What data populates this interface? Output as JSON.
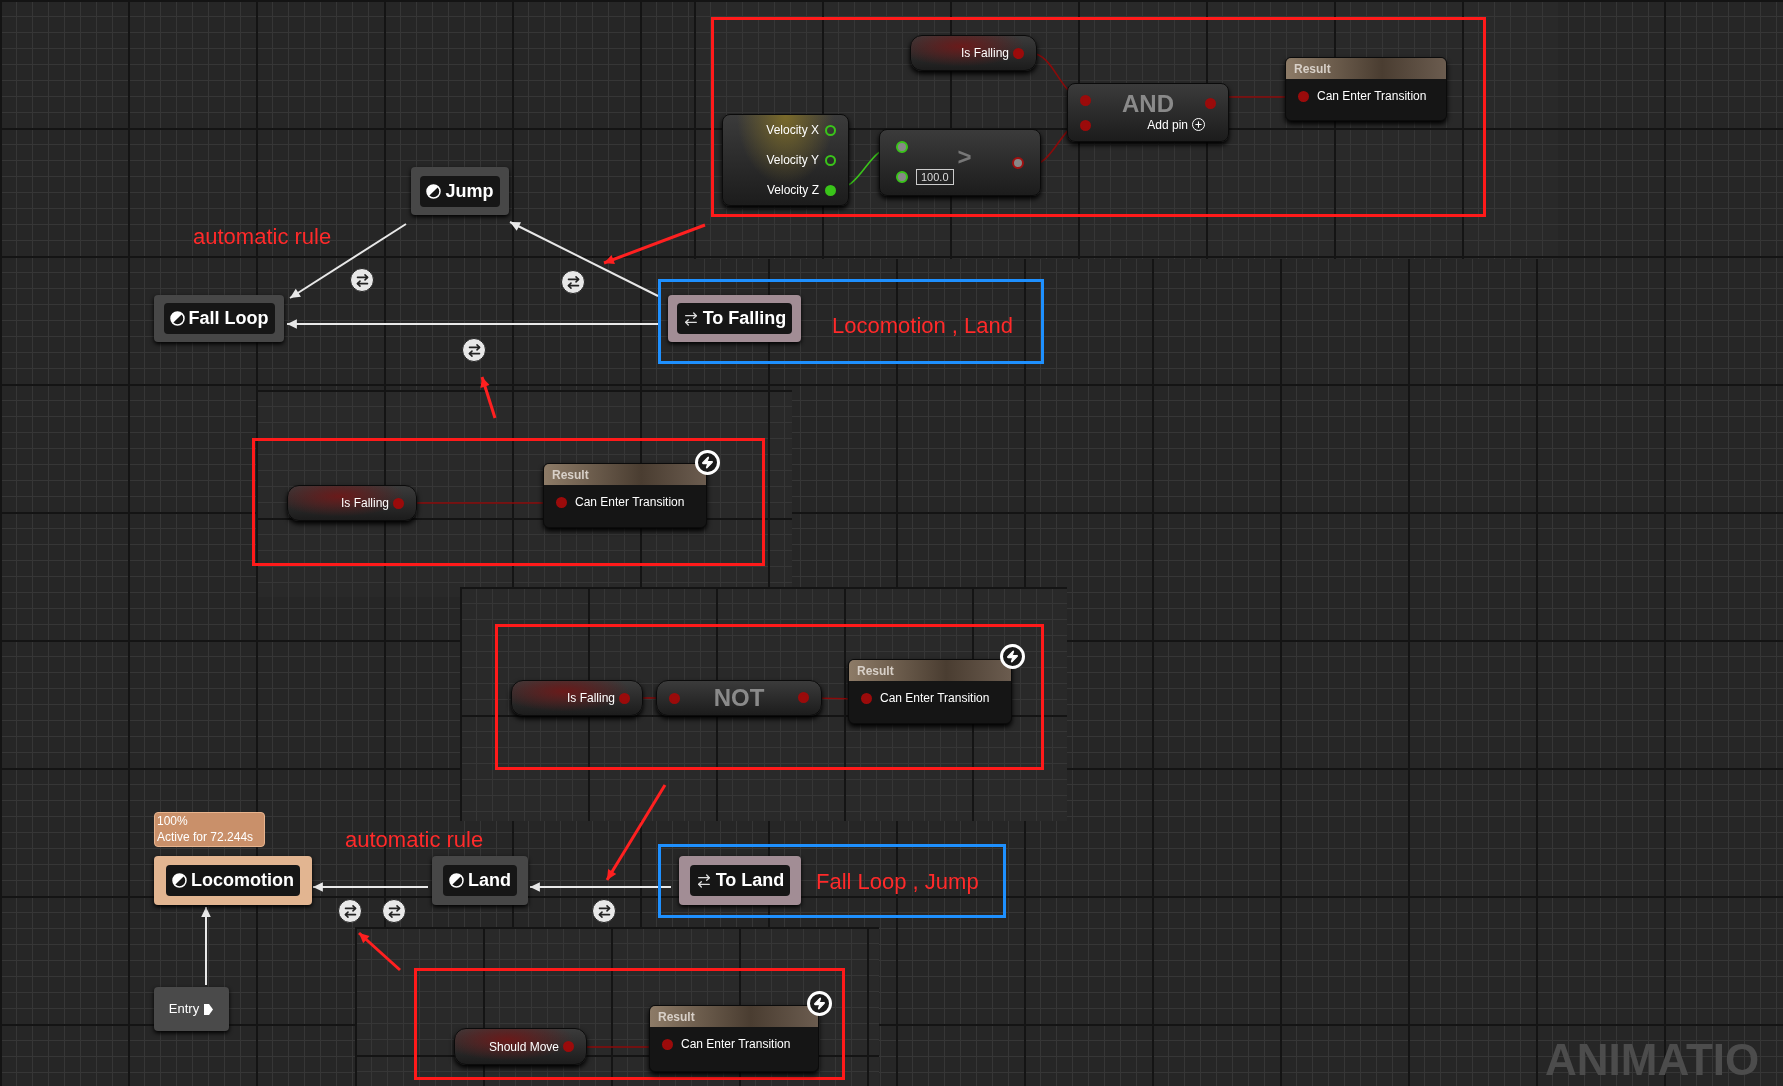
{
  "state_machine": {
    "states": [
      {
        "kind": "state",
        "label": "Jump",
        "active": false
      },
      {
        "kind": "state",
        "label": "Fall Loop",
        "active": false
      },
      {
        "kind": "conduit",
        "label": "To Falling"
      },
      {
        "kind": "state",
        "label": "Locomotion",
        "active": true
      },
      {
        "kind": "state",
        "label": "Land",
        "active": false
      },
      {
        "kind": "conduit",
        "label": "To Land"
      },
      {
        "kind": "entry",
        "label": "Entry"
      }
    ],
    "active_badge": {
      "percent": "100%",
      "time": "Active for 72.244s"
    }
  },
  "notes": [
    {
      "text": "automatic rule"
    },
    {
      "text": "Locomotion , Land"
    },
    {
      "text": "automatic rule"
    },
    {
      "text": "Fall Loop , Jump"
    }
  ],
  "rule_graphs": [
    {
      "nodes": [
        {
          "kind": "variable",
          "label": "Is Falling"
        },
        {
          "kind": "break",
          "pins": [
            {
              "label": "Velocity X",
              "connected": false
            },
            {
              "label": "Velocity Y",
              "connected": false
            },
            {
              "label": "Velocity Z",
              "connected": true
            }
          ]
        },
        {
          "kind": "compare",
          "operator": ">",
          "value": "100.0"
        },
        {
          "kind": "operator",
          "label": "AND",
          "add_pin": "Add pin"
        },
        {
          "kind": "result",
          "title": "Result",
          "pin": "Can Enter Transition"
        }
      ]
    },
    {
      "nodes": [
        {
          "kind": "variable",
          "label": "Is Falling"
        },
        {
          "kind": "result",
          "title": "Result",
          "pin": "Can Enter Transition"
        }
      ]
    },
    {
      "nodes": [
        {
          "kind": "variable",
          "label": "Is Falling"
        },
        {
          "kind": "operator",
          "label": "NOT"
        },
        {
          "kind": "result",
          "title": "Result",
          "pin": "Can Enter Transition"
        }
      ]
    },
    {
      "nodes": [
        {
          "kind": "variable",
          "label": "Should Move"
        },
        {
          "kind": "result",
          "title": "Result",
          "pin": "Can Enter Transition"
        }
      ]
    }
  ],
  "graph_label": "ANIMATIO"
}
